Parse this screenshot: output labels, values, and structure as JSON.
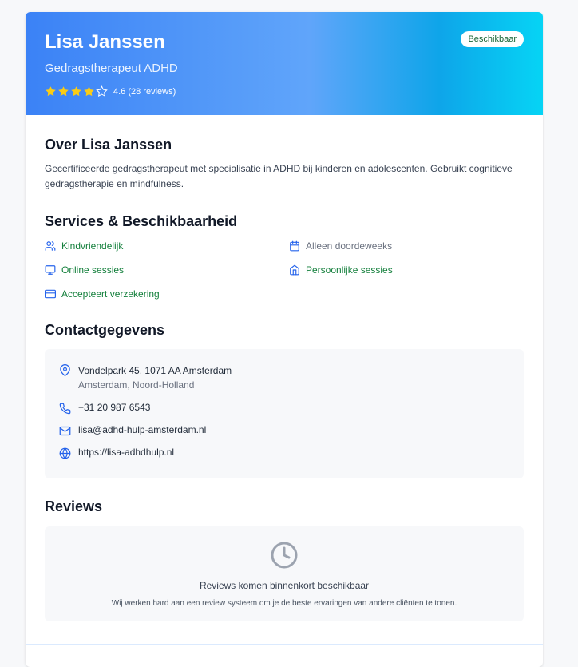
{
  "profile": {
    "name": "Lisa Janssen",
    "subtitle": "Gedragstherapeut ADHD",
    "rating_text": "4.6 (28 reviews)",
    "rating_value": 4.6,
    "rating_max": 5,
    "status_badge": "Beschikbaar"
  },
  "about": {
    "heading": "Over Lisa Janssen",
    "text": "Gecertificeerde gedragstherapeut met specialisatie in ADHD bij kinderen en adolescenten. Gebruikt cognitieve gedragstherapie en mindfulness."
  },
  "services": {
    "heading": "Services & Beschikbaarheid",
    "items": [
      {
        "label": "Kindvriendelijk",
        "icon": "users-icon",
        "color": "#15803d"
      },
      {
        "label": "Alleen doordeweeks",
        "icon": "calendar-icon",
        "color": "#6b7280"
      },
      {
        "label": "Online sessies",
        "icon": "monitor-icon",
        "color": "#15803d"
      },
      {
        "label": "Persoonlijke sessies",
        "icon": "home-icon",
        "color": "#15803d"
      },
      {
        "label": "Accepteert verzekering",
        "icon": "credit-card-icon",
        "color": "#15803d"
      }
    ]
  },
  "contact": {
    "heading": "Contactgegevens",
    "address_line1": "Vondelpark 45, 1071 AA Amsterdam",
    "address_line2": "Amsterdam, Noord-Holland",
    "phone": "+31 20 987 6543",
    "email": "lisa@adhd-hulp-amsterdam.nl",
    "website": "https://lisa-adhdhulp.nl"
  },
  "reviews": {
    "heading": "Reviews",
    "empty_title": "Reviews komen binnenkort beschikbaar",
    "empty_subtitle": "Wij werken hard aan een review systeem om je de beste ervaringen van andere cliënten te tonen."
  },
  "colors": {
    "accent_blue": "#3b82f6",
    "icon_blue": "#2563eb",
    "star_yellow": "#facc15",
    "green_text": "#15803d"
  }
}
